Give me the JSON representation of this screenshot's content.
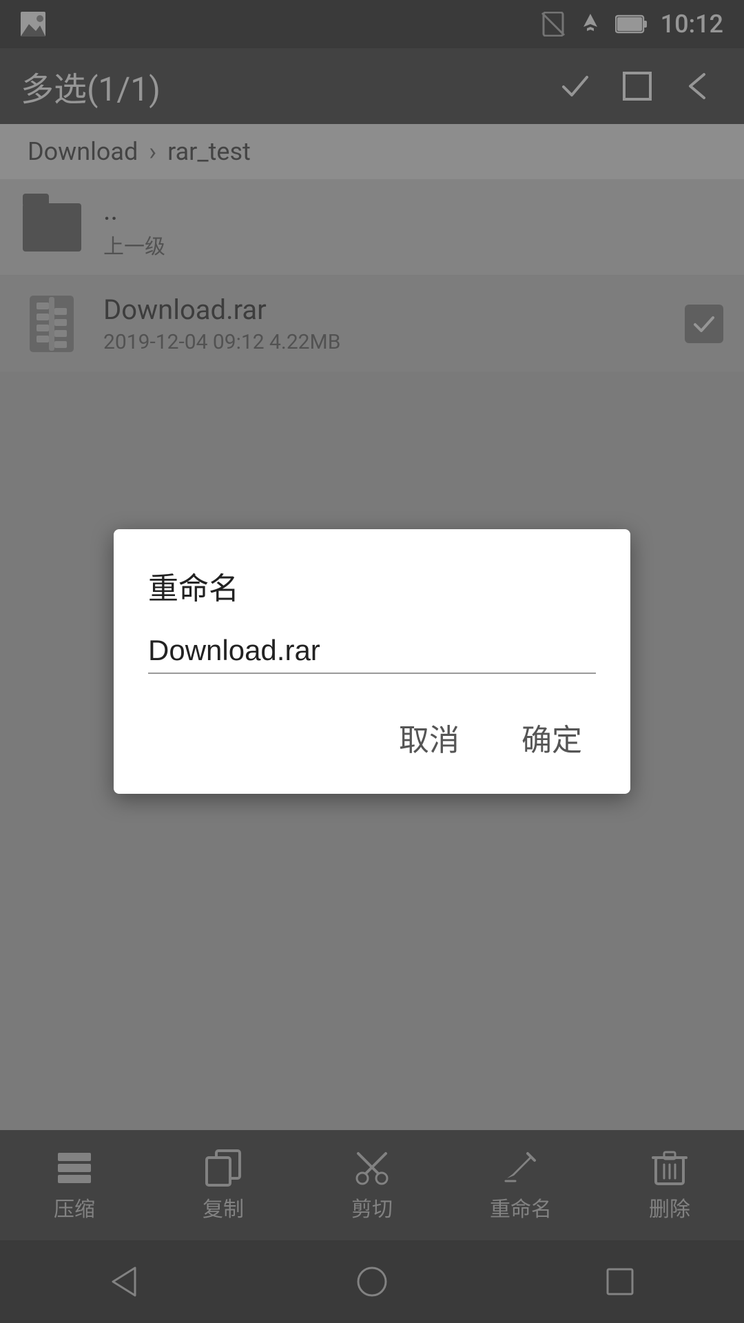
{
  "statusBar": {
    "time": "10:12"
  },
  "toolbar": {
    "title": "多选(1/1)",
    "checkLabel": "✓",
    "squareLabel": "□",
    "backLabel": "←"
  },
  "breadcrumb": {
    "path1": "Download",
    "separator": ">",
    "path2": "rar_test"
  },
  "fileList": [
    {
      "type": "folder",
      "name": "..",
      "subtitle": "上一级"
    },
    {
      "type": "rar",
      "name": "Download.rar",
      "meta": "2019-12-04 09:12  4.22MB",
      "selected": true
    }
  ],
  "dialog": {
    "title": "重命名",
    "inputValue": "Download.rar",
    "cancelLabel": "取消",
    "confirmLabel": "确定"
  },
  "bottomNav": [
    {
      "label": "压缩",
      "icon": "compress"
    },
    {
      "label": "复制",
      "icon": "copy"
    },
    {
      "label": "剪切",
      "icon": "cut"
    },
    {
      "label": "重命名",
      "icon": "rename"
    },
    {
      "label": "删除",
      "icon": "delete"
    }
  ],
  "sysNav": {
    "backLabel": "◁",
    "homeLabel": "○",
    "recentsLabel": "□"
  }
}
